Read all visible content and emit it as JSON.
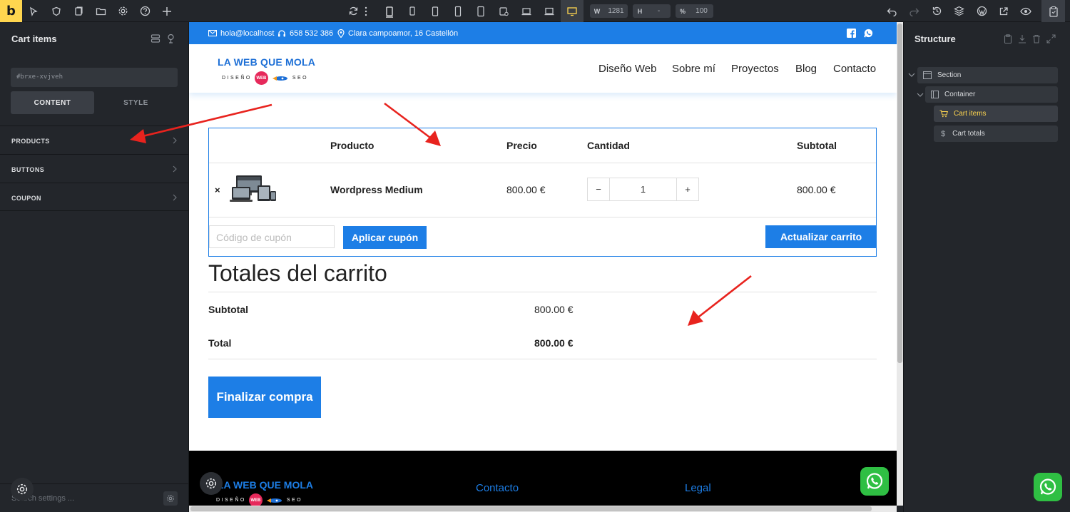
{
  "toolbar": {
    "logo_letter": "b",
    "width_key": "W",
    "width_value": "1281",
    "height_key": "H",
    "height_value": "-",
    "zoom_key": "%",
    "zoom_value": "100"
  },
  "left_panel": {
    "title": "Cart items",
    "element_id": "#brxe-xvjveh",
    "tabs": [
      "CONTENT",
      "STYLE"
    ],
    "active_tab": "CONTENT",
    "sections": [
      "PRODUCTS",
      "BUTTONS",
      "COUPON"
    ],
    "search_placeholder": "Search settings ..."
  },
  "canvas": {
    "topbar": {
      "email": "hola@localhost",
      "phone": "658 532 386",
      "address": "Clara campoamor, 16 Castellón"
    },
    "brand": {
      "name": "LA WEB QUE MOLA",
      "left_word": "DISEÑO",
      "badge": "WEB",
      "right_word": "SEO"
    },
    "nav": [
      "Diseño Web",
      "Sobre mí",
      "Proyectos",
      "Blog",
      "Contacto"
    ],
    "cart": {
      "headers": [
        "Producto",
        "Precio",
        "Cantidad",
        "Subtotal"
      ],
      "item": {
        "remove": "×",
        "name": "Wordpress Medium",
        "price": "800.00 €",
        "qty_minus": "−",
        "qty_value": "1",
        "qty_plus": "+",
        "subtotal": "800.00 €"
      },
      "coupon_placeholder": "Código de cupón",
      "apply_coupon": "Aplicar cupón",
      "update_cart": "Actualizar carrito"
    },
    "totals": {
      "title": "Totales del carrito",
      "subtotal_label": "Subtotal",
      "subtotal_value": "800.00 €",
      "total_label": "Total",
      "total_value": "800.00 €",
      "checkout": "Finalizar compra"
    },
    "footer": {
      "brand_name": "LA WEB QUE MOLA",
      "col_contacto": "Contacto",
      "col_legal": "Legal"
    }
  },
  "right_panel": {
    "title": "Structure",
    "tree": [
      {
        "label": "Section",
        "icon": "section-icon"
      },
      {
        "label": "Container",
        "icon": "container-icon"
      },
      {
        "label": "Cart items",
        "icon": "cart-icon",
        "selected": true
      },
      {
        "label": "Cart totals",
        "icon": "dollar-icon"
      }
    ]
  },
  "colors": {
    "accent_blue": "#1d7ee6",
    "builder_yellow": "#ffd64f",
    "panel_bg": "#23262b",
    "annotation_red": "#e8231e",
    "whatsapp_green": "#2fbf43"
  }
}
